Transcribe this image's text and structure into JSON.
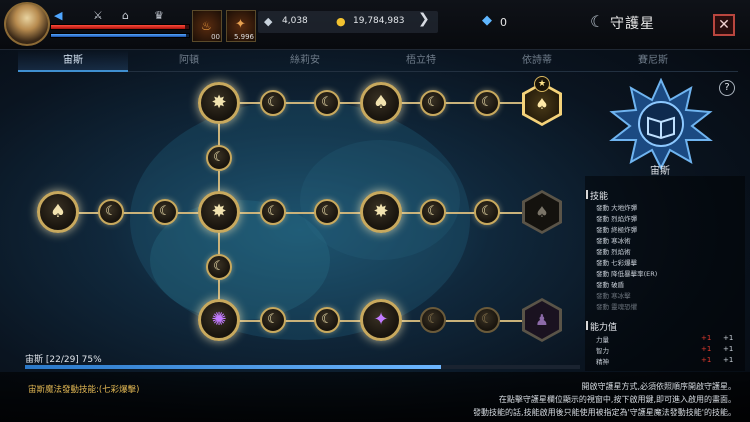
{
  "header": {
    "title": "守護星",
    "currency_silver": "4,038",
    "currency_gold": "19,784,983",
    "crystals": "0",
    "item_slots": [
      {
        "name": "potion",
        "count": "00"
      },
      {
        "name": "scroll",
        "count": "5.996"
      }
    ],
    "hp_percent": 97,
    "mp_percent": 98
  },
  "tabs": [
    {
      "label": "宙斯",
      "active": true
    },
    {
      "label": "阿頓",
      "active": false
    },
    {
      "label": "絲莉安",
      "active": false
    },
    {
      "label": "梧立特",
      "active": false
    },
    {
      "label": "依詩蒂",
      "active": false
    },
    {
      "label": "賽尼斯",
      "active": false
    }
  ],
  "constellation": {
    "name": "宙斯",
    "progress_label": "宙斯 [22/29] 75%",
    "progress_percent": 75
  },
  "skills_section": {
    "title": "技能",
    "items": [
      {
        "label": "發動 大地炸彈",
        "active": true
      },
      {
        "label": "發動 烈焰炸彈",
        "active": true
      },
      {
        "label": "發動 終極炸彈",
        "active": true
      },
      {
        "label": "發動 寒冰術",
        "active": true
      },
      {
        "label": "發動 烈焰術",
        "active": true
      },
      {
        "label": "發動 七彩爆擊",
        "active": true
      },
      {
        "label": "發動 降低暴擊率(ER)",
        "active": true
      },
      {
        "label": "發動 破盾",
        "active": true
      },
      {
        "label": "發動 寒冰擊",
        "active": false
      },
      {
        "label": "發動 靈魂恐懼",
        "active": false
      }
    ]
  },
  "stats_section": {
    "title": "能力值",
    "items": [
      {
        "name": "力量",
        "add": "+1",
        "total": "+1"
      },
      {
        "name": "智力",
        "add": "+1",
        "total": "+1"
      },
      {
        "name": "精神",
        "add": "+1",
        "total": "+1"
      }
    ]
  },
  "footer": {
    "skill_info": "宙斯魔法發動技能:(七彩爆擊)",
    "instructions": [
      "開啟守護星方式,必須依照順序開啟守護星。",
      "在點擊守護星欄位顯示的視窗中,按下啟用鍵,即可進入啟用的畫面。",
      "發動技能的話,技能啟用後只能使用被指定為'守護星魔法發動技能'的技能。"
    ]
  },
  "colors": {
    "gold": "#c8a95e",
    "accent_blue": "#3f8fd0",
    "red_stat": "#e03a2e",
    "skill_text": "#e0b653"
  }
}
